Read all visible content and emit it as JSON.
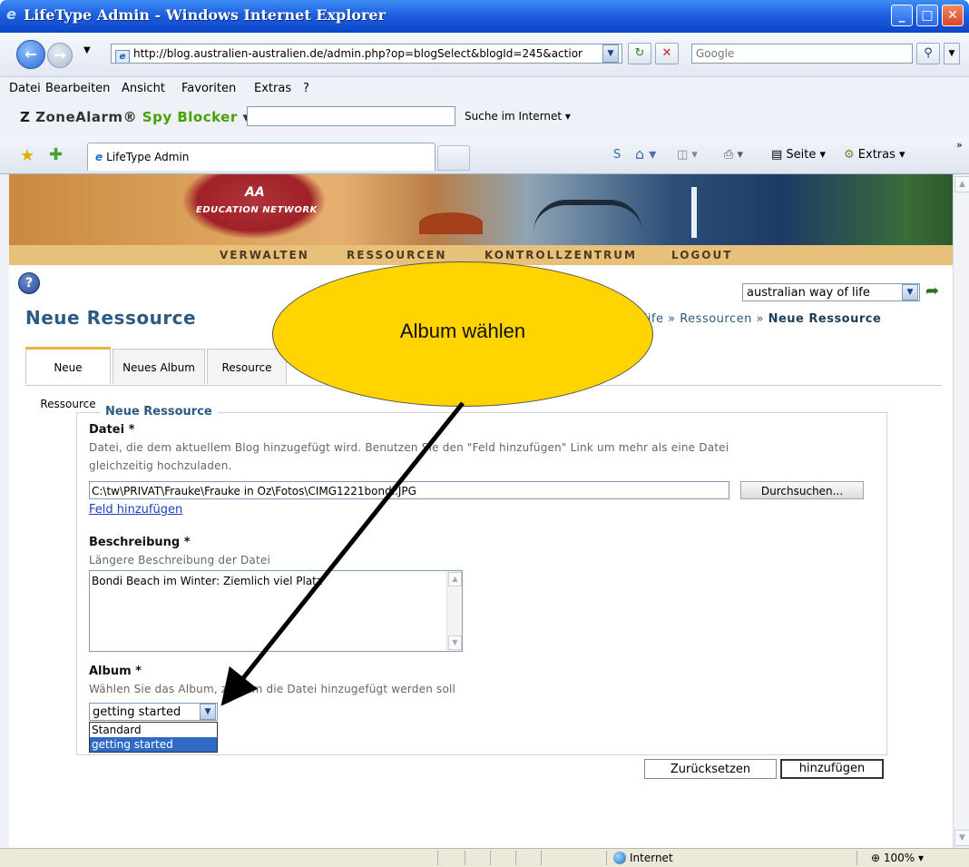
{
  "window": {
    "title": "LifeType Admin - Windows Internet Explorer",
    "min": "_",
    "max": "□",
    "close": "✕"
  },
  "nav": {
    "address": "http://blog.australien-australien.de/admin.php?op=blogSelect&blogId=245&actior",
    "search_placeholder": "Google"
  },
  "menu": [
    "Datei",
    "Bearbeiten",
    "Ansicht",
    "Favoriten",
    "Extras",
    "?"
  ],
  "zonealarm": {
    "logo_z": "Z",
    "logo_zone": "ZoneAlarm",
    "logo_spy": "Spy Blocker",
    "search_label": "Suche im Internet"
  },
  "ie_tabs": {
    "tab_label": "LifeType Admin",
    "page_label": "Seite",
    "extras_label": "Extras"
  },
  "banner": {
    "aa": "AA",
    "edu": "EDUCATION NETWORK"
  },
  "topnav": [
    "VERWALTEN",
    "RESSOURCEN",
    "KONTROLLZENTRUM",
    "LOGOUT"
  ],
  "blog_select": "australian way of life",
  "page": {
    "title": "Neue Ressource",
    "breadcrumb_prefix": "f life » Ressourcen » ",
    "breadcrumb_current": "Neue Ressource"
  },
  "tabs": [
    "Neue Ressource",
    "Neues Album",
    "Resource"
  ],
  "form": {
    "legend": "Neue Ressource",
    "file_label": "Datei *",
    "file_hint_line1": "Datei, die dem aktuellem Blog hinzugefügt wird. Benutzen Sie den \"Feld hinzufügen\" Link um mehr als eine Datei",
    "file_hint_line2": "gleichzeitig hochzuladen.",
    "file_value": "C:\\tw\\PRIVAT\\Frauke\\Frauke in Oz\\Fotos\\CIMG1221bondi.JPG",
    "browse_label": "Durchsuchen...",
    "add_field_link": "Feld hinzufügen",
    "desc_label": "Beschreibung *",
    "desc_hint": "Längere Beschreibung der Datei",
    "desc_value": "Bondi Beach im Winter: Ziemlich viel Platz",
    "album_label": "Album *",
    "album_hint": "Wählen Sie das Album, zu dem die Datei hinzugefügt werden soll",
    "album_selected": "getting started",
    "album_options": [
      "Standard",
      "getting started"
    ],
    "reset_label": "Zurücksetzen",
    "submit_label": "hinzufügen"
  },
  "callout": {
    "text": "Album wählen"
  },
  "status": {
    "zone": "Internet",
    "zoom": "100%"
  }
}
